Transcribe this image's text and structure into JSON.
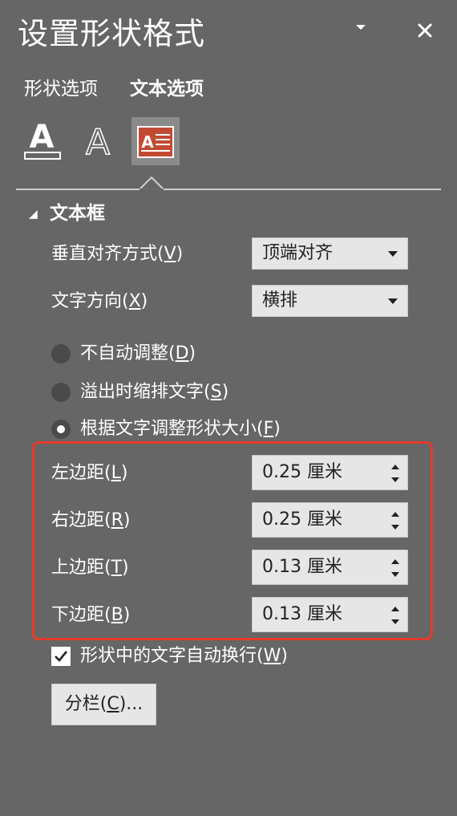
{
  "panel": {
    "title": "设置形状格式",
    "pin_icon": "chevron-down-icon",
    "close_icon": "close-icon"
  },
  "tabs": [
    {
      "label": "形状选项",
      "active": false
    },
    {
      "label": "文本选项",
      "active": true
    }
  ],
  "icon_tabs": [
    {
      "name": "text-fill-outline-icon",
      "active": false
    },
    {
      "name": "text-effects-icon",
      "active": false
    },
    {
      "name": "textbox-icon",
      "active": true
    }
  ],
  "section": {
    "title": "文本框",
    "expanded": true
  },
  "vertical_align": {
    "label": "垂直对齐方式(",
    "key": "V",
    "label_end": ")",
    "value": "顶端对齐"
  },
  "text_direction": {
    "label": "文字方向(",
    "key": "X",
    "label_end": ")",
    "value": "横排"
  },
  "autofit": [
    {
      "label": "不自动调整(",
      "key": "D",
      "label_end": ")",
      "checked": false
    },
    {
      "label": "溢出时缩排文字(",
      "key": "S",
      "label_end": ")",
      "checked": false
    },
    {
      "label": "根据文字调整形状大小(",
      "key": "F",
      "label_end": ")",
      "checked": true
    }
  ],
  "margins": [
    {
      "label": "左边距(",
      "key": "L",
      "label_end": ")",
      "value": "0.25 厘米"
    },
    {
      "label": "右边距(",
      "key": "R",
      "label_end": ")",
      "value": "0.25 厘米"
    },
    {
      "label": "上边距(",
      "key": "T",
      "label_end": ")",
      "value": "0.13 厘米"
    },
    {
      "label": "下边距(",
      "key": "B",
      "label_end": ")",
      "value": "0.13 厘米"
    }
  ],
  "wrap_text": {
    "label": "形状中的文字自动换行(",
    "key": "W",
    "label_end": ")",
    "checked": true
  },
  "columns_button": {
    "label": "分栏(",
    "key": "C",
    "label_end": ")..."
  },
  "colors": {
    "background": "#666666",
    "highlight_border": "#e83a2a",
    "control_bg": "#e6e6e6"
  }
}
